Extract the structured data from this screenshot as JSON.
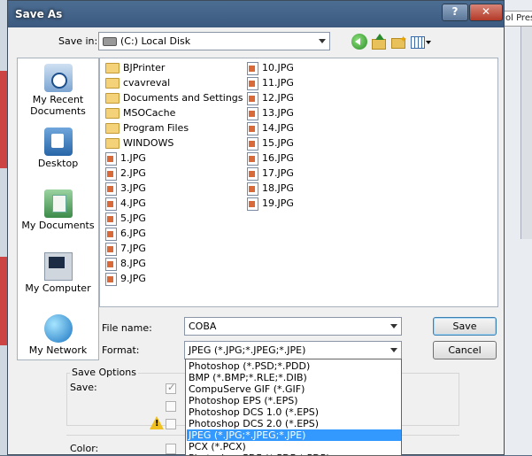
{
  "window": {
    "title": "Save As",
    "help_glyph": "?",
    "close_glyph": "✕"
  },
  "background_app": {
    "strip_text": "ol Prese"
  },
  "save_in": {
    "label": "Save in:",
    "value": "(C:) Local Disk"
  },
  "toolbar": {
    "back_icon": "back-arrow-icon",
    "up_icon": "up-one-level-icon",
    "new_folder_icon": "new-folder-icon",
    "view_icon": "view-menu-icon"
  },
  "places": [
    {
      "label": "My Recent Documents",
      "icon": "recent-documents-icon"
    },
    {
      "label": "Desktop",
      "icon": "desktop-icon"
    },
    {
      "label": "My Documents",
      "icon": "my-documents-icon"
    },
    {
      "label": "My Computer",
      "icon": "my-computer-icon"
    },
    {
      "label": "My Network",
      "icon": "network-icon"
    }
  ],
  "files_col1": [
    {
      "name": "BJPrinter",
      "type": "folder"
    },
    {
      "name": "cvavreval",
      "type": "folder"
    },
    {
      "name": "Documents and Settings",
      "type": "folder"
    },
    {
      "name": "MSOCache",
      "type": "folder"
    },
    {
      "name": "Program Files",
      "type": "folder"
    },
    {
      "name": "WINDOWS",
      "type": "folder"
    },
    {
      "name": "1.JPG",
      "type": "jpg"
    },
    {
      "name": "2.JPG",
      "type": "jpg"
    },
    {
      "name": "3.JPG",
      "type": "jpg"
    },
    {
      "name": "4.JPG",
      "type": "jpg"
    },
    {
      "name": "5.JPG",
      "type": "jpg"
    },
    {
      "name": "6.JPG",
      "type": "jpg"
    },
    {
      "name": "7.JPG",
      "type": "jpg"
    },
    {
      "name": "8.JPG",
      "type": "jpg"
    },
    {
      "name": "9.JPG",
      "type": "jpg"
    }
  ],
  "files_col2": [
    {
      "name": "10.JPG",
      "type": "jpg"
    },
    {
      "name": "11.JPG",
      "type": "jpg"
    },
    {
      "name": "12.JPG",
      "type": "jpg"
    },
    {
      "name": "13.JPG",
      "type": "jpg"
    },
    {
      "name": "14.JPG",
      "type": "jpg"
    },
    {
      "name": "15.JPG",
      "type": "jpg"
    },
    {
      "name": "16.JPG",
      "type": "jpg"
    },
    {
      "name": "17.JPG",
      "type": "jpg"
    },
    {
      "name": "18.JPG",
      "type": "jpg"
    },
    {
      "name": "19.JPG",
      "type": "jpg"
    }
  ],
  "file_name": {
    "label": "File name:",
    "value": "COBA"
  },
  "format": {
    "label": "Format:",
    "value": "JPEG (*.JPG;*.JPEG;*.JPE)",
    "options": [
      "Photoshop (*.PSD;*.PDD)",
      "BMP (*.BMP;*.RLE;*.DIB)",
      "CompuServe GIF (*.GIF)",
      "Photoshop EPS (*.EPS)",
      "Photoshop DCS 1.0 (*.EPS)",
      "Photoshop DCS 2.0 (*.EPS)",
      "JPEG (*.JPG;*.JPEG;*.JPE)",
      "PCX (*.PCX)",
      "Photoshop PDF (*.PDF;*.PDP)"
    ],
    "selected_index": 6
  },
  "buttons": {
    "save": "Save",
    "cancel": "Cancel"
  },
  "save_options": {
    "title": "Save Options",
    "save_label": "Save:",
    "color_label": "Color:"
  },
  "colors": {
    "selection": "#3399ff",
    "titlebar": "#3c5a80"
  }
}
